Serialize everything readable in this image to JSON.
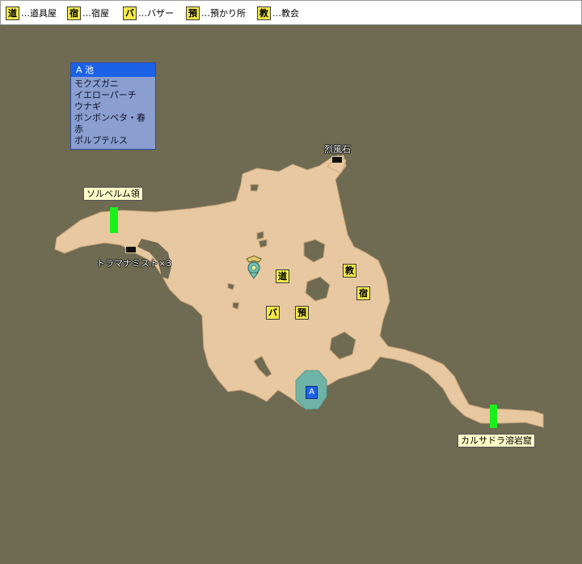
{
  "legend": [
    {
      "badge": "道",
      "label": "…道具屋"
    },
    {
      "badge": "宿",
      "label": "…宿屋"
    },
    {
      "badge": "バ",
      "label": "…バザー"
    },
    {
      "badge": "預",
      "label": "…預かり所"
    },
    {
      "badge": "教",
      "label": "…教会"
    }
  ],
  "pond": {
    "marker": "A",
    "title": "A 池",
    "fish": [
      "モクズガニ",
      "イエローパーチ",
      "ウナギ",
      "ボンボンベタ・春赤",
      "ポルプテルス"
    ]
  },
  "labels": {
    "west_exit": "ソルベルム領",
    "east_exit": "カルサドラ溶岩窟",
    "item_north": "烈風石",
    "item_west": "トラマナミスト×3"
  },
  "facilities": {
    "item_shop": "道",
    "church": "教",
    "inn": "宿",
    "bazaar": "バ",
    "storage": "預"
  },
  "colors": {
    "background": "#6f6a52",
    "cave_floor": "#e8c8a0",
    "pond": "#6fb3a6",
    "exit": "#19f01b",
    "badge": "#f4ea4a"
  }
}
